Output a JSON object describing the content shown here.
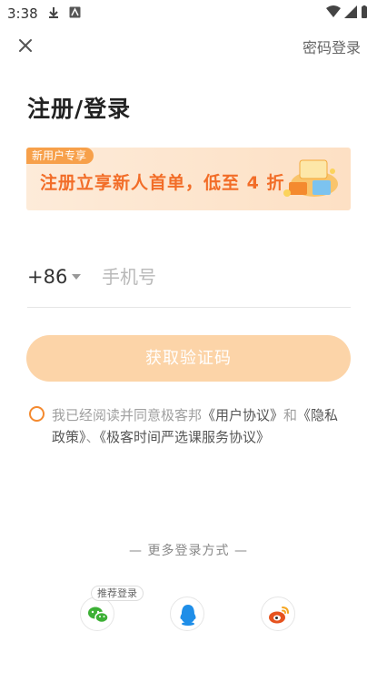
{
  "status_bar": {
    "time": "3:38"
  },
  "header": {
    "password_login_label": "密码登录"
  },
  "page_title": "注册/登录",
  "banner": {
    "badge": "新用户专享",
    "text": "注册立享新人首单，低至 4 折"
  },
  "phone": {
    "country_code": "+86",
    "placeholder": "手机号"
  },
  "get_code_button": {
    "label": "获取验证码",
    "state": "disabled"
  },
  "agreement": {
    "prefix": "我已经阅读并同意极客邦",
    "user_agreement": "《用户协议》",
    "and": "和",
    "privacy_policy": "《隐私政策》",
    "sep": "、",
    "service_agreement": "《极客时间严选课服务协议》",
    "checked": false
  },
  "more_login": {
    "label": "— 更多登录方式 —",
    "recommended_tag": "推荐登录",
    "options": [
      {
        "name": "wechat",
        "icon": "wechat-icon",
        "color": "#3cb035"
      },
      {
        "name": "qq",
        "icon": "qq-icon",
        "color": "#1f8ee8"
      },
      {
        "name": "weibo",
        "icon": "weibo-icon",
        "color": "#e6531f"
      }
    ]
  },
  "colors": {
    "accent": "#f48a2f",
    "button_disabled": "#fcd4a8",
    "banner_text": "#f26d28"
  }
}
